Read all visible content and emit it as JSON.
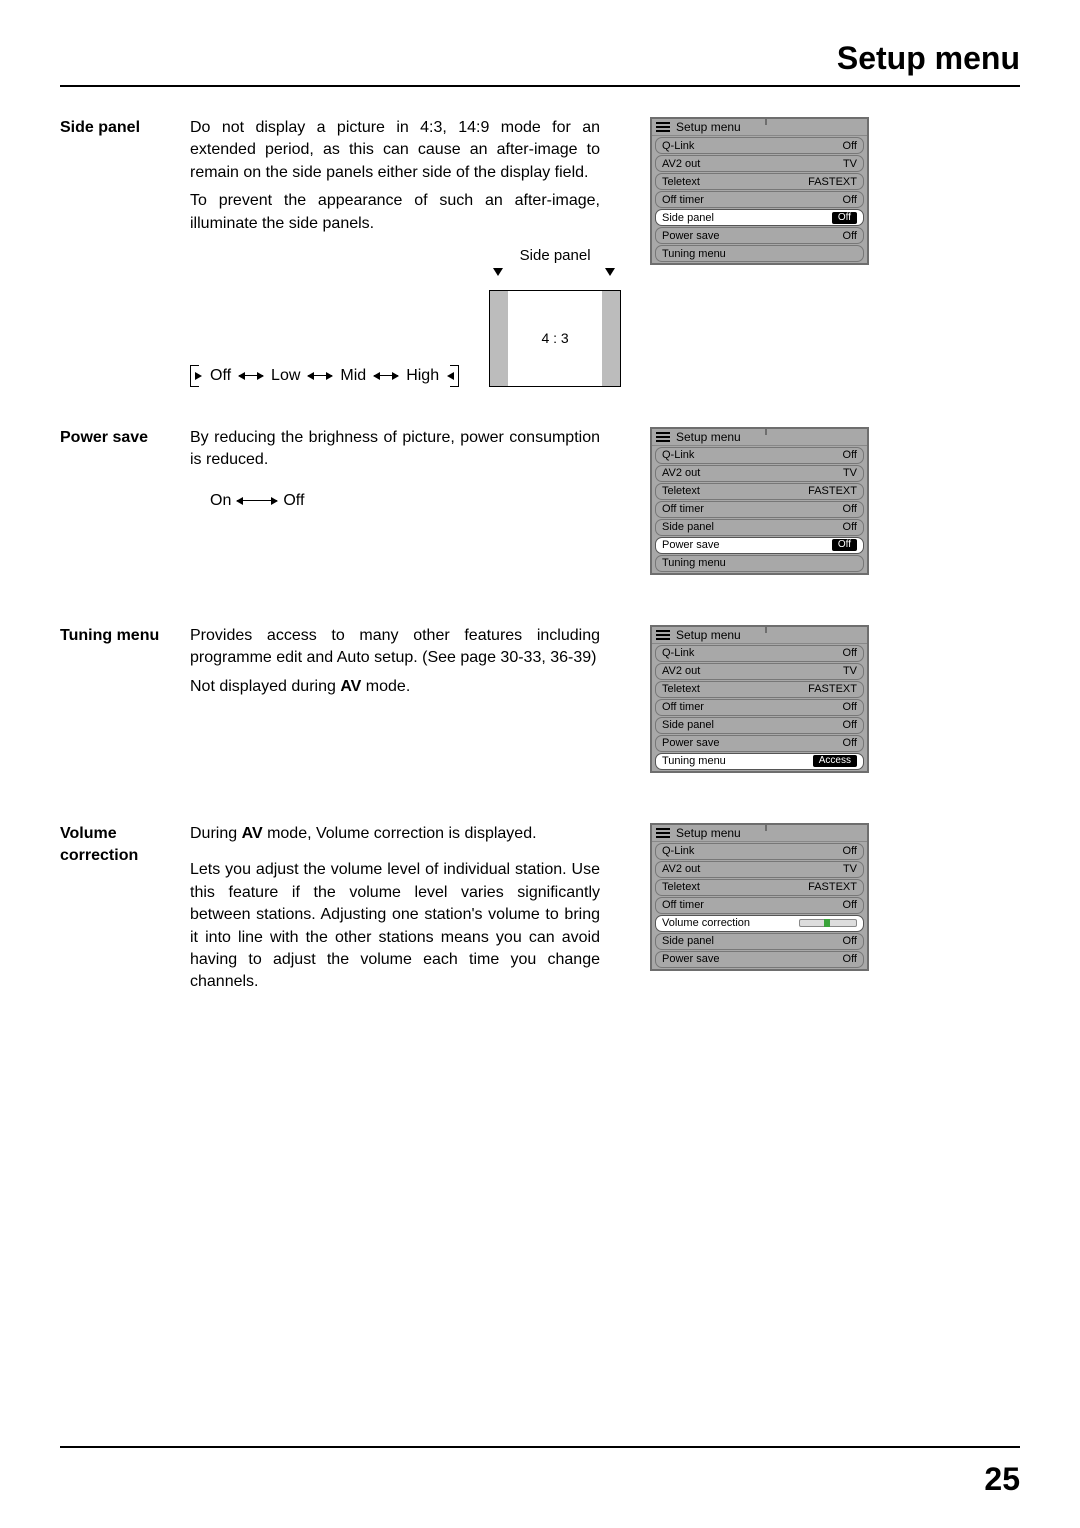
{
  "page_title": "Setup menu",
  "page_number": "25",
  "sections": {
    "side_panel": {
      "label": "Side panel",
      "p1": "Do not display a picture in 4:3, 14:9 mode for an extended period, as this can cause an after-image to remain on the side panels either side of the display field.",
      "p2": "To prevent the appearance of such an after-image, illuminate the side panels.",
      "diagram_label": "Side panel",
      "diagram_ratio": "4 : 3",
      "opts": [
        "Off",
        "Low",
        "Mid",
        "High"
      ]
    },
    "power_save": {
      "label": "Power save",
      "p1": "By reducing the brighness of picture, power consumption is reduced.",
      "opts": [
        "On",
        "Off"
      ]
    },
    "tuning_menu": {
      "label": "Tuning menu",
      "p1": "Provides access to many other features including programme edit and Auto setup. (See page 30-33, 36-39)",
      "p2a": "Not displayed during ",
      "p2b": "AV",
      "p2c": " mode."
    },
    "volume_correction": {
      "label": "Volume correction",
      "p1a": "During ",
      "p1b": "AV",
      "p1c": " mode, Volume correction is displayed.",
      "p2": "Lets you adjust the volume level of individual station. Use this feature if the volume level varies significantly between stations. Adjusting one station's volume to bring it into line with the other stations means you can avoid having to adjust the volume each time you change channels."
    }
  },
  "osd_title": "Setup menu",
  "osd1": [
    {
      "name": "Q-Link",
      "val": "Off",
      "sel": false
    },
    {
      "name": "AV2 out",
      "val": "TV",
      "sel": false
    },
    {
      "name": "Teletext",
      "val": "FASTEXT",
      "sel": false
    },
    {
      "name": "Off timer",
      "val": "Off",
      "sel": false
    },
    {
      "name": "Side panel",
      "val": "Off",
      "sel": true,
      "pill": true
    },
    {
      "name": "Power save",
      "val": "Off",
      "sel": false
    },
    {
      "name": "Tuning menu",
      "val": "",
      "sel": false
    }
  ],
  "osd2": [
    {
      "name": "Q-Link",
      "val": "Off",
      "sel": false
    },
    {
      "name": "AV2 out",
      "val": "TV",
      "sel": false
    },
    {
      "name": "Teletext",
      "val": "FASTEXT",
      "sel": false
    },
    {
      "name": "Off timer",
      "val": "Off",
      "sel": false
    },
    {
      "name": "Side panel",
      "val": "Off",
      "sel": false
    },
    {
      "name": "Power save",
      "val": "Off",
      "sel": true,
      "pill": true
    },
    {
      "name": "Tuning menu",
      "val": "",
      "sel": false
    }
  ],
  "osd3": [
    {
      "name": "Q-Link",
      "val": "Off",
      "sel": false
    },
    {
      "name": "AV2 out",
      "val": "TV",
      "sel": false
    },
    {
      "name": "Teletext",
      "val": "FASTEXT",
      "sel": false
    },
    {
      "name": "Off timer",
      "val": "Off",
      "sel": false
    },
    {
      "name": "Side panel",
      "val": "Off",
      "sel": false
    },
    {
      "name": "Power save",
      "val": "Off",
      "sel": false
    },
    {
      "name": "Tuning menu",
      "val": "Access",
      "sel": true,
      "pill": true
    }
  ],
  "osd4": [
    {
      "name": "Q-Link",
      "val": "Off",
      "sel": false
    },
    {
      "name": "AV2 out",
      "val": "TV",
      "sel": false
    },
    {
      "name": "Teletext",
      "val": "FASTEXT",
      "sel": false
    },
    {
      "name": "Off timer",
      "val": "Off",
      "sel": false
    },
    {
      "name": "Volume correction",
      "val": "",
      "sel": true,
      "slider": true
    },
    {
      "name": "Side panel",
      "val": "Off",
      "sel": false
    },
    {
      "name": "Power save",
      "val": "Off",
      "sel": false
    }
  ]
}
